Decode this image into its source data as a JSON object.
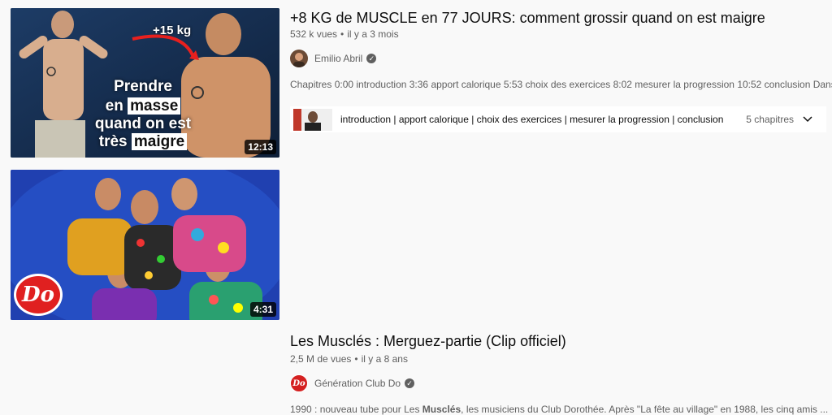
{
  "results": [
    {
      "title": "+8 KG de MUSCLE en 77 JOURS: comment grossir quand on est maigre",
      "views": "532 k vues",
      "age": "il y a 3 mois",
      "channel": "Emilio Abril",
      "description": "Chapitres 0:00 introduction 3:36 apport calorique 5:53 choix des exercices 8:02 mesurer la progression 10:52 conclusion Dans ...",
      "duration": "12:13",
      "thumb_overlay": {
        "weight_label": "+15 kg",
        "line1": "Prendre",
        "line2a": "en",
        "line2b": "masse",
        "line3": "quand on est",
        "line4a": "très",
        "line4b": "maigre"
      },
      "chapters": {
        "text": "introduction | apport calorique | choix des exercices | mesurer la progression | conclusion",
        "count": "5 chapitres"
      }
    },
    {
      "title": "Les Musclés : Merguez-partie (Clip officiel)",
      "views": "2,5 M de vues",
      "age": "il y a 8 ans",
      "channel": "Génération Club Do",
      "description_pre": "1990 : nouveau tube pour Les ",
      "description_bold": "Musclés",
      "description_post": ", les musiciens du Club Dorothée. Après \"La fête au village\" en 1988, les cinq amis ...",
      "duration": "4:31",
      "logo_text": "Do"
    }
  ],
  "colors": {
    "background": "#f9f9f9",
    "title": "#0f0f0f",
    "meta": "#606060",
    "logo_red": "#e02020"
  }
}
